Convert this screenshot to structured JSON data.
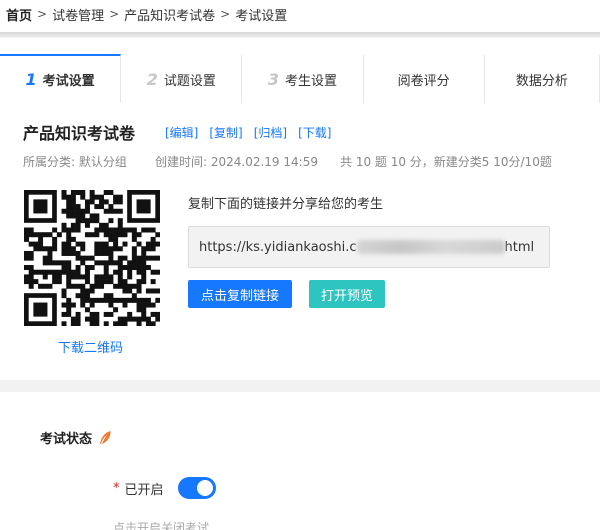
{
  "breadcrumb": {
    "home": "首页",
    "items": [
      "试卷管理",
      "产品知识考试卷",
      "考试设置"
    ],
    "separator": ">"
  },
  "tabs": [
    {
      "num": "1",
      "label": "考试设置",
      "active": true
    },
    {
      "num": "2",
      "label": "试题设置",
      "active": false
    },
    {
      "num": "3",
      "label": "考生设置",
      "active": false
    },
    {
      "num": "",
      "label": "阅卷评分",
      "active": false
    },
    {
      "num": "",
      "label": "数据分析",
      "active": false
    }
  ],
  "paper": {
    "title": "产品知识考试卷",
    "actions": [
      "[编辑]",
      "[复制]",
      "[归档]",
      "[下载]"
    ],
    "category": "所属分类: 默认分组",
    "created": "创建时间: 2024.02.19 14:59",
    "summary": "共 10 题 10 分，新建分类5 10分/10题"
  },
  "share": {
    "label": "复制下面的链接并分享给您的考生",
    "link_prefix": "https://ks.yidiankaoshi.c",
    "link_suffix": "html",
    "copy_button": "点击复制链接",
    "preview_button": "打开预览",
    "qr_download": "下载二维码"
  },
  "status": {
    "title": "考试状态",
    "required_mark": "*",
    "toggle_label": "已开启",
    "toggle_on": true,
    "hint": "点击开启关闭考试"
  },
  "colors": {
    "accent": "#1677ff",
    "teal": "#2ec4c0",
    "required": "#e02020",
    "feather": "#f0782a"
  },
  "icons": {
    "status_title_icon": "feather-icon"
  }
}
